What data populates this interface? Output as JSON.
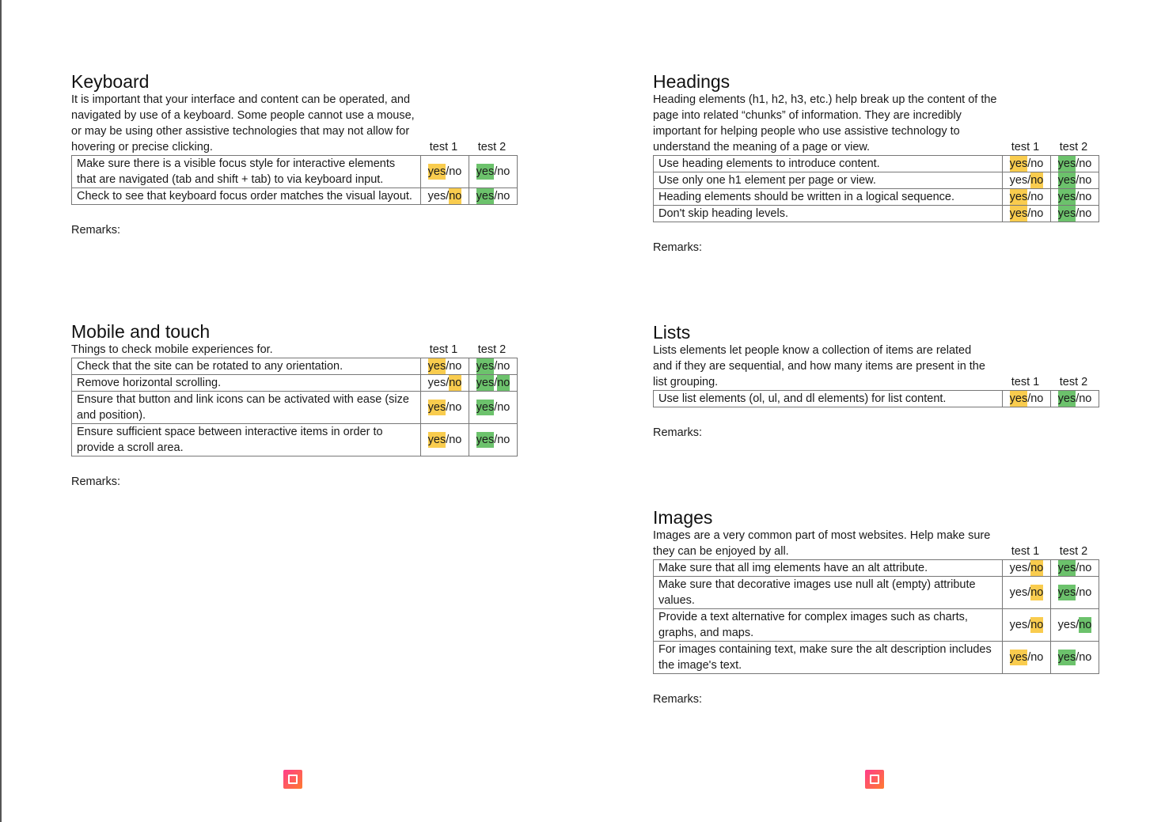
{
  "test1_label": "test 1",
  "test2_label": "test 2",
  "remarks_label": "Remarks:",
  "yes_label": "yes",
  "no_label": "no",
  "highlight_colors": {
    "test1": "#f9cc4e",
    "test2": "#6cc26c"
  },
  "sections": {
    "keyboard": {
      "title": "Keyboard",
      "description": "It is important that your interface and content can be operated, and navigated by use of a keyboard. Some people cannot use a mouse, or may be using other assistive technologies that may not allow for hovering or precise clicking.",
      "rows": [
        {
          "text": "Make sure there is a visible focus style for interactive elements that are navigated (tab and shift + tab) to via keyboard input.",
          "test1": "yes",
          "test2": "yes"
        },
        {
          "text": "Check to see that keyboard focus order matches the visual layout.",
          "test1": "no",
          "test2": "yes"
        }
      ]
    },
    "mobile": {
      "title": "Mobile and touch",
      "description": "Things to check mobile experiences for.",
      "rows": [
        {
          "text": "Check that the site can be rotated to any orientation.",
          "test1": "yes",
          "test2": "yes"
        },
        {
          "text": "Remove horizontal scrolling.",
          "test1": "no",
          "test2": "both"
        },
        {
          "text": "Ensure that button and link icons can be activated with ease (size and position).",
          "test1": "yes",
          "test2": "yes"
        },
        {
          "text": "Ensure sufficient space between interactive items in order to provide a scroll area.",
          "test1": "yes",
          "test2": "yes"
        }
      ]
    },
    "headings": {
      "title": "Headings",
      "description": "Heading elements (h1, h2, h3, etc.) help break up the content of the page into related “chunks” of information. They are incredibly important for helping people who use assistive technology to understand the meaning of a page or view.",
      "rows": [
        {
          "text": "Use heading elements to introduce content.",
          "test1": "yes",
          "test2": "yes"
        },
        {
          "text": "Use only one h1 element per page or view.",
          "test1": "no",
          "test2": "yes"
        },
        {
          "text": "Heading elements should be written in a logical sequence.",
          "test1": "yes",
          "test2": "yes"
        },
        {
          "text": "Don't skip heading levels.",
          "test1": "yes",
          "test2": "yes"
        }
      ]
    },
    "lists": {
      "title": "Lists",
      "description": "Lists elements let people know a collection of items are related and if they are sequential, and how many items are present in the list grouping.",
      "rows": [
        {
          "text": "Use list elements (ol, ul, and dl elements) for list content.",
          "test1": "yes",
          "test2": "yes"
        }
      ]
    },
    "images": {
      "title": "Images",
      "description": "Images are a very common part of most websites. Help make sure they can be enjoyed by all.",
      "rows": [
        {
          "text": "Make sure that all img elements have an alt attribute.",
          "test1": "no",
          "test2": "yes"
        },
        {
          "text": "Make sure that decorative images use null alt (empty) attribute values.",
          "test1": "no",
          "test2": "yes"
        },
        {
          "text": "Provide a text alternative for complex images such as charts, graphs, and maps.",
          "test1": "no",
          "test2": "no"
        },
        {
          "text": "For images containing text, make sure the alt description includes the image's text.",
          "test1": "yes",
          "test2": "yes"
        }
      ]
    }
  }
}
